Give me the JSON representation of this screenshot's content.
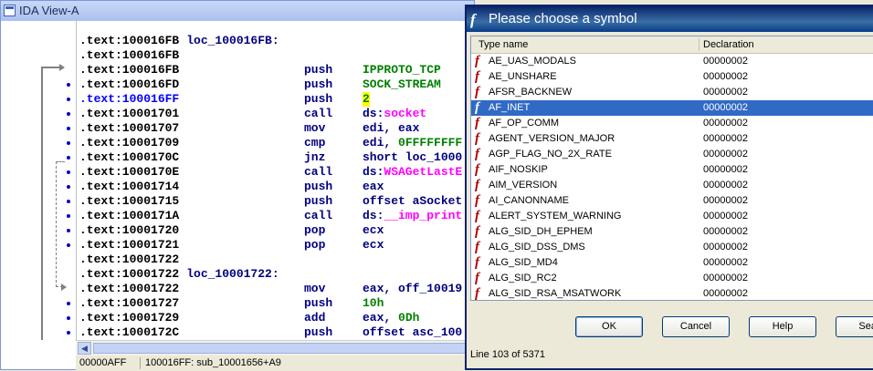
{
  "ida": {
    "title": "IDA View-A",
    "lines": [
      {
        "addr": ".text:100016FB",
        "label": "loc_100016FB:",
        "mnemonic": "",
        "operand": ""
      },
      {
        "addr": ".text:100016FB",
        "label": "",
        "mnemonic": "",
        "operand": ""
      },
      {
        "addr": ".text:100016FB",
        "label": "",
        "mnemonic": "push",
        "operand": "IPPROTO_TCP"
      },
      {
        "addr": ".text:100016FD",
        "label": "",
        "mnemonic": "push",
        "operand": "SOCK_STREAM"
      },
      {
        "addr": ".text:100016FF",
        "label": "",
        "mnemonic": "push",
        "operand": "2"
      },
      {
        "addr": ".text:10001701",
        "label": "",
        "mnemonic": "call",
        "operand": "ds:socket"
      },
      {
        "addr": ".text:10001707",
        "label": "",
        "mnemonic": "mov",
        "operand": "edi, eax"
      },
      {
        "addr": ".text:10001709",
        "label": "",
        "mnemonic": "cmp",
        "operand": "edi, 0FFFFFFFF"
      },
      {
        "addr": ".text:1000170C",
        "label": "",
        "mnemonic": "jnz",
        "operand": "short loc_1000"
      },
      {
        "addr": ".text:1000170E",
        "label": "",
        "mnemonic": "call",
        "operand": "ds:WSAGetLastE"
      },
      {
        "addr": ".text:10001714",
        "label": "",
        "mnemonic": "push",
        "operand": "eax"
      },
      {
        "addr": ".text:10001715",
        "label": "",
        "mnemonic": "push",
        "operand": "offset aSocket"
      },
      {
        "addr": ".text:1000171A",
        "label": "",
        "mnemonic": "call",
        "operand": "ds:__imp_print"
      },
      {
        "addr": ".text:10001720",
        "label": "",
        "mnemonic": "pop",
        "operand": "ecx"
      },
      {
        "addr": ".text:10001721",
        "label": "",
        "mnemonic": "pop",
        "operand": "ecx"
      },
      {
        "addr": ".text:10001722",
        "label": "",
        "mnemonic": "",
        "operand": ""
      },
      {
        "addr": ".text:10001722",
        "label": "loc_10001722:",
        "mnemonic": "",
        "operand": ""
      },
      {
        "addr": ".text:10001722",
        "label": "",
        "mnemonic": "mov",
        "operand": "eax, off_10019"
      },
      {
        "addr": ".text:10001727",
        "label": "",
        "mnemonic": "push",
        "operand": "10h"
      },
      {
        "addr": ".text:10001729",
        "label": "",
        "mnemonic": "add",
        "operand": "eax, 0Dh"
      },
      {
        "addr": ".text:1000172C",
        "label": "",
        "mnemonic": "push",
        "operand": "offset asc_100"
      }
    ],
    "status_offset": "00000AFF",
    "status_location": "100016FF: sub_10001656+A9",
    "colors": {
      "address": "#000000",
      "mnemonic": "#000080",
      "constant": "#008000",
      "import": "#ff00ff",
      "highlight": "#ffff00"
    }
  },
  "dialog": {
    "title": "Please choose a symbol",
    "col_name": "Type name",
    "col_decl": "Declaration",
    "rows": [
      {
        "name": "AE_UAS_MODALS",
        "decl": "00000002"
      },
      {
        "name": "AE_UNSHARE",
        "decl": "00000002"
      },
      {
        "name": "AFSR_BACKNEW",
        "decl": "00000002"
      },
      {
        "name": "AF_INET",
        "decl": "00000002"
      },
      {
        "name": "AF_OP_COMM",
        "decl": "00000002"
      },
      {
        "name": "AGENT_VERSION_MAJOR",
        "decl": "00000002"
      },
      {
        "name": "AGP_FLAG_NO_2X_RATE",
        "decl": "00000002"
      },
      {
        "name": "AIF_NOSKIP",
        "decl": "00000002"
      },
      {
        "name": "AIM_VERSION",
        "decl": "00000002"
      },
      {
        "name": "AI_CANONNAME",
        "decl": "00000002"
      },
      {
        "name": "ALERT_SYSTEM_WARNING",
        "decl": "00000002"
      },
      {
        "name": "ALG_SID_DH_EPHEM",
        "decl": "00000002"
      },
      {
        "name": "ALG_SID_DSS_DMS",
        "decl": "00000002"
      },
      {
        "name": "ALG_SID_MD4",
        "decl": "00000002"
      },
      {
        "name": "ALG_SID_RC2",
        "decl": "00000002"
      },
      {
        "name": "ALG_SID_RSA_MSATWORK",
        "decl": "00000002"
      }
    ],
    "selected_index": 3,
    "buttons": {
      "ok": "OK",
      "cancel": "Cancel",
      "help": "Help",
      "search": "Sear"
    },
    "line_info": "Line 103 of 5371",
    "colors": {
      "selection": "#316ac5",
      "icon": "#b00000",
      "title_bar": "#0a246a"
    }
  }
}
